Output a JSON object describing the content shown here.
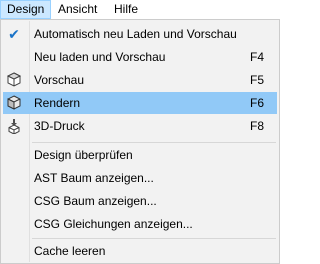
{
  "menubar": {
    "items": [
      {
        "label": "Design"
      },
      {
        "label": "Ansicht"
      },
      {
        "label": "Hilfe"
      }
    ]
  },
  "dropdown": {
    "items": [
      {
        "label": "Automatisch neu Laden und Vorschau",
        "shortcut": "",
        "checked": true,
        "icon": "checkmark-icon"
      },
      {
        "label": "Neu laden und Vorschau",
        "shortcut": "F4",
        "icon": ""
      },
      {
        "label": "Vorschau",
        "shortcut": "F5",
        "icon": "preview-cube-icon"
      },
      {
        "label": "Rendern",
        "shortcut": "F6",
        "icon": "render-cube-icon",
        "highlighted": true
      },
      {
        "label": "3D-Druck",
        "shortcut": "F8",
        "icon": "3d-print-icon"
      },
      {
        "label": "Design überprüfen",
        "shortcut": ""
      },
      {
        "label": "AST Baum anzeigen...",
        "shortcut": ""
      },
      {
        "label": "CSG Baum anzeigen...",
        "shortcut": ""
      },
      {
        "label": "CSG Gleichungen anzeigen...",
        "shortcut": ""
      },
      {
        "label": "Cache leeren",
        "shortcut": ""
      }
    ]
  },
  "colors": {
    "highlight": "#91c9f7",
    "menu_bg": "#f2f2f2",
    "active_menubar": "#cce8ff",
    "check": "#1a73c8"
  }
}
